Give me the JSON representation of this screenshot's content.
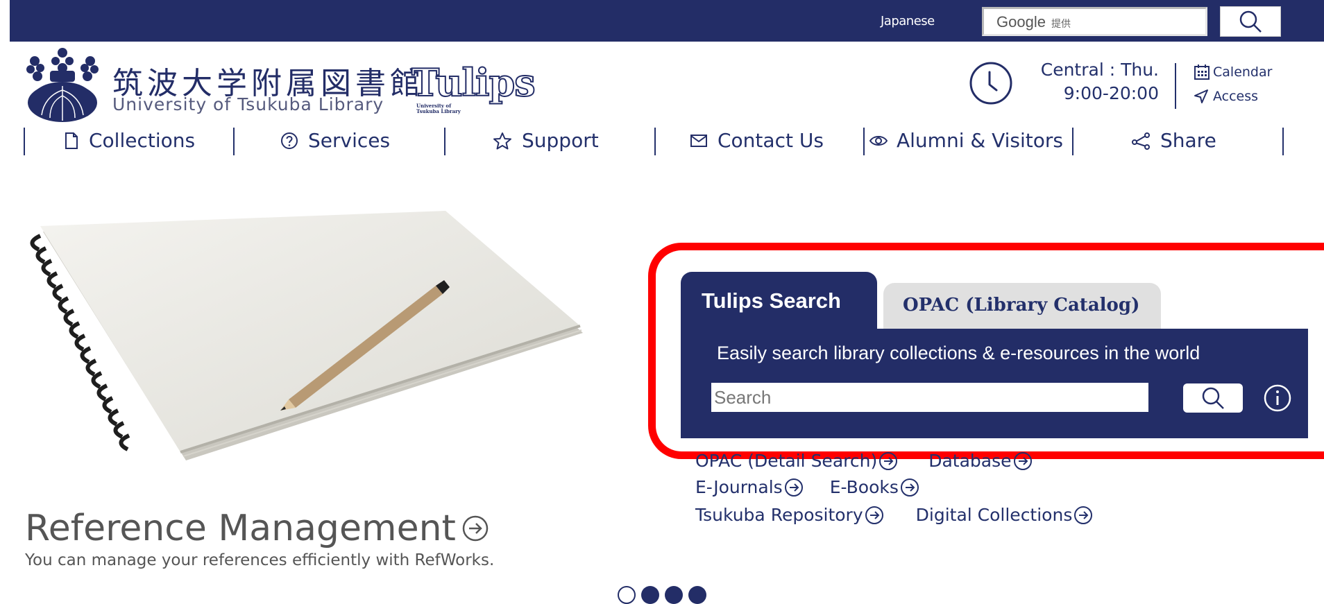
{
  "topbar": {
    "language_link": "Japanese",
    "google_label": "Google",
    "google_sub": "提供"
  },
  "header": {
    "logo_jp": "筑波大学附属図書館",
    "logo_en": "University of Tsukuba Library",
    "tulips_logo": "Tulips",
    "tulips_sub_1": "University of",
    "tulips_sub_2": "Tsukuba Library",
    "hours_name": "Central : Thu.",
    "hours_time": "9:00-20:00",
    "calendar_label": "Calendar",
    "access_label": "Access"
  },
  "nav": {
    "collections": "Collections",
    "services": "Services",
    "support": "Support",
    "contact": "Contact Us",
    "alumni": "Alumni & Visitors",
    "share": "Share"
  },
  "hero": {
    "title": "Reference Management",
    "description": "You can manage your references efficiently with RefWorks."
  },
  "search": {
    "tab_active": "Tulips Search",
    "tab_inactive": "OPAC (Library Catalog)",
    "description": "Easily search library collections & e-resources in the world",
    "placeholder": "Search"
  },
  "quick_links": {
    "opac_detail": "OPAC (Detail Search)",
    "database": "Database",
    "ejournals": "E-Journals",
    "ebooks": "E-Books",
    "repository": "Tsukuba Repository",
    "digital": "Digital Collections"
  },
  "carousel": {
    "total": 4,
    "active_index": 0
  },
  "colors": {
    "brand": "#232d67",
    "highlight": "#ff0000",
    "tab_inactive": "#e0e0e0"
  }
}
